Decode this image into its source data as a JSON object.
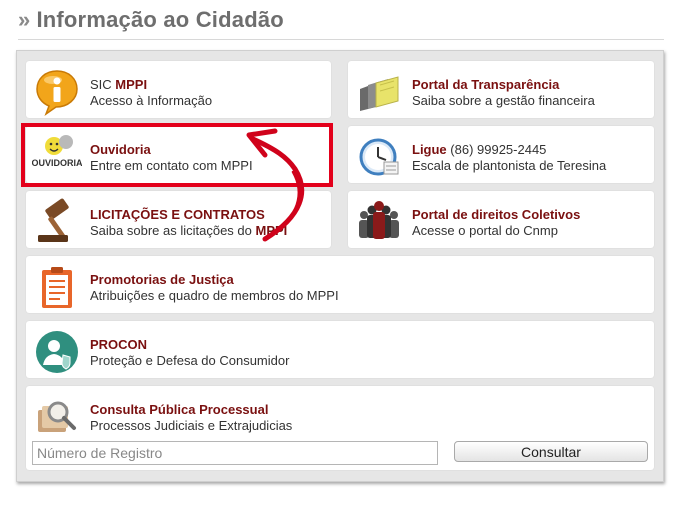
{
  "header": {
    "raquo": "»",
    "title": "Informação ao Cidadão"
  },
  "cards": {
    "sic": {
      "title_plain": "SIC ",
      "title_bold": "MPPI",
      "subtitle": "Acesso à Informação",
      "icon": "info-icon"
    },
    "portal": {
      "title": "Portal da Transparência",
      "subtitle": "Saiba sobre a gestão financeira",
      "icon": "documents-icon"
    },
    "ouvidoria": {
      "title": "Ouvidoria",
      "subtitle": "Entre em contato com MPPI",
      "icon": "ouvidoria-logo",
      "logo_text": "OUVIDORIA"
    },
    "ligue": {
      "title": "Ligue",
      "phone": " (86) 99925-2445",
      "subtitle": "Escala de plantonista de Teresina",
      "icon": "clock-icon"
    },
    "licitacoes": {
      "title": "LICITAÇÕES E CONTRATOS",
      "subtitle_plain": "Saiba sobre as licitações do ",
      "subtitle_bold": "MPPI",
      "icon": "gavel-icon"
    },
    "direitos": {
      "title": "Portal de direitos Coletivos",
      "subtitle": "Acesse o portal do Cnmp",
      "icon": "people-icon"
    },
    "promotorias": {
      "title": "Promotorias de Justiça",
      "subtitle": "Atribuições e quadro de membros do MPPI",
      "icon": "clipboard-icon"
    },
    "procon": {
      "title": "PROCON",
      "subtitle": "Proteção e Defesa do Consumidor",
      "icon": "consumer-icon"
    },
    "consulta": {
      "title": "Consulta Pública Processual",
      "subtitle": "Processos Judiciais e Extrajudicias",
      "icon": "magnifier-folder-icon",
      "input_value": "",
      "input_placeholder": "Número de Registro",
      "button_label": "Consultar"
    }
  },
  "colors": {
    "accent": "#7a1010",
    "highlight": "#e3001b",
    "panel": "#e6e6e6"
  }
}
